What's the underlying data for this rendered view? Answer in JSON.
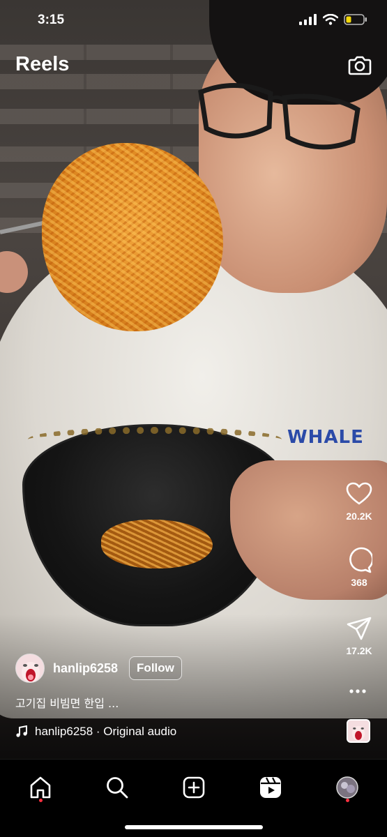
{
  "status_bar": {
    "time": "3:15"
  },
  "header": {
    "title": "Reels",
    "camera_icon": "camera-icon"
  },
  "video": {
    "shirt_print": "WHALE"
  },
  "actions": {
    "like": {
      "icon": "heart-icon",
      "count": "20.2K"
    },
    "comment": {
      "icon": "comment-bubble-icon",
      "count": "368"
    },
    "share": {
      "icon": "paper-plane-icon",
      "count": "17.2K"
    },
    "more_icon": "more-horizontal-icon"
  },
  "post": {
    "username": "hanlip6258",
    "follow_label": "Follow",
    "caption": "고기집 비빔면 한입 ...",
    "audio": "hanlip6258 · Original audio",
    "audio_icon": "music-note-icon"
  },
  "nav": {
    "items": [
      {
        "name": "home",
        "icon": "home-icon",
        "notification": true
      },
      {
        "name": "search",
        "icon": "search-icon",
        "notification": false
      },
      {
        "name": "create",
        "icon": "plus-square-icon",
        "notification": false
      },
      {
        "name": "reels",
        "icon": "reels-icon",
        "notification": false
      },
      {
        "name": "profile",
        "icon": "profile-avatar-icon",
        "notification": true
      }
    ]
  },
  "colors": {
    "notification_dot": "#ff3040",
    "background": "#000000",
    "text": "#ffffff"
  }
}
